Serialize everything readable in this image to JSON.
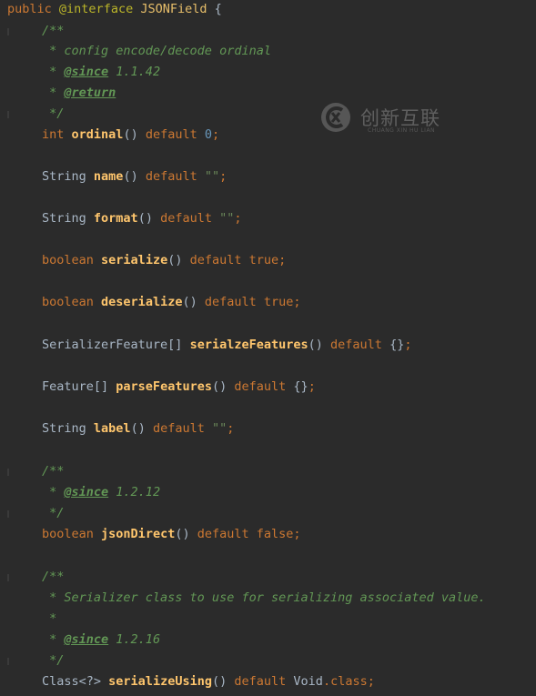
{
  "editor": {
    "decl": {
      "kw_public": "public",
      "kw_interface": "@interface",
      "name": "JSONField",
      "brace": "{"
    },
    "doc1": {
      "open": "/**",
      "text": " * config encode/decode ordinal",
      "since_star": " * ",
      "since_tag": "@since",
      "since_val": " 1.1.42",
      "return_star": " * ",
      "return_tag": "@return",
      "close": " */"
    },
    "ordinal": {
      "type": "int",
      "name": "ordinal",
      "parens": "()",
      "kw": "default",
      "val": "0",
      "end": ";"
    },
    "name": {
      "type": "String",
      "name": "name",
      "parens": "()",
      "kw": "default",
      "val": "\"\"",
      "end": ";"
    },
    "format": {
      "type": "String",
      "name": "format",
      "parens": "()",
      "kw": "default",
      "val": "\"\"",
      "end": ";"
    },
    "serialize": {
      "type": "boolean",
      "name": "serialize",
      "parens": "()",
      "kw": "default",
      "val": "true",
      "end": ";"
    },
    "deserialize": {
      "type": "boolean",
      "name": "deserialize",
      "parens": "()",
      "kw": "default",
      "val": "true",
      "end": ";"
    },
    "serialzeFeatures": {
      "type": "SerializerFeature[]",
      "name": "serialzeFeatures",
      "parens": "()",
      "kw": "default",
      "val": "{}",
      "end": ";"
    },
    "parseFeatures": {
      "type": "Feature[]",
      "name": "parseFeatures",
      "parens": "()",
      "kw": "default",
      "val": "{}",
      "end": ";"
    },
    "label": {
      "type": "String",
      "name": "label",
      "parens": "()",
      "kw": "default",
      "val": "\"\"",
      "end": ";"
    },
    "doc2": {
      "open": "/**",
      "since_star": " * ",
      "since_tag": "@since",
      "since_val": " 1.2.12",
      "close": " */"
    },
    "jsonDirect": {
      "type": "boolean",
      "name": "jsonDirect",
      "parens": "()",
      "kw": "default",
      "val": "false",
      "end": ";"
    },
    "doc3": {
      "open": "/**",
      "text": " * Serializer class to use for serializing associated value.",
      "star": " *",
      "since_star": " * ",
      "since_tag": "@since",
      "since_val": " 1.2.16",
      "close": " */"
    },
    "serializeUsing": {
      "type": "Class<?>",
      "name": "serializeUsing",
      "parens": "()",
      "kw": "default",
      "val_type": "Void",
      "val_dot": ".",
      "val_kw": "class",
      "end": ";"
    }
  },
  "watermark": {
    "text": "创新互联",
    "sub": "CHUANG XIN HU LIAN"
  },
  "colors": {
    "background": "#2b2b2b",
    "keyword": "#cc7832",
    "annotation": "#bbb529",
    "method": "#ffc66d",
    "string": "#6a8759",
    "number": "#6897bb",
    "doc_comment": "#629755",
    "plain": "#a9b7c6"
  }
}
